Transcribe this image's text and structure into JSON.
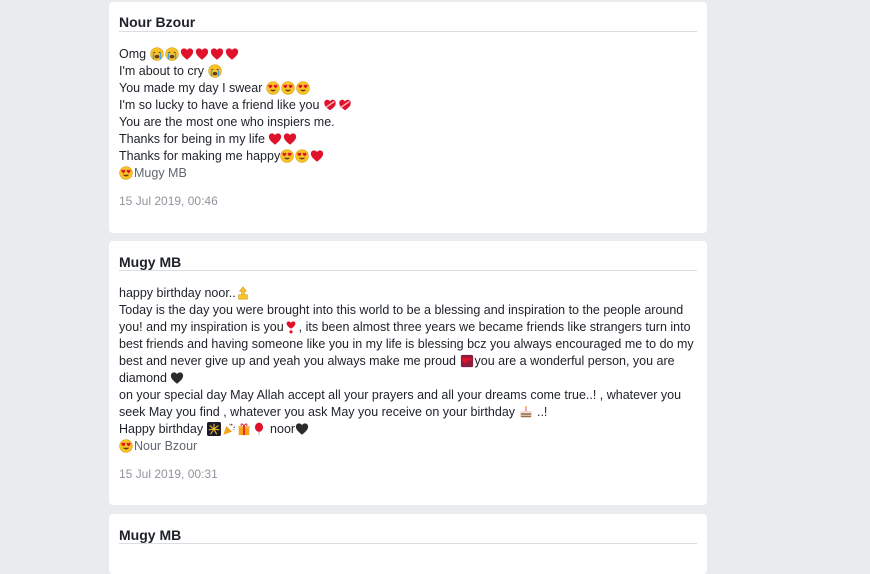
{
  "posts": [
    {
      "author": "Nour Bzour",
      "lines": [
        {
          "text": "Omg ",
          "emojis": [
            "crying-face-icon",
            "crying-face-icon",
            "heart-icon",
            "heart-icon",
            "heart-icon",
            "heart-icon"
          ]
        },
        {
          "text": "I'm about to cry ",
          "emojis": [
            "crying-face-icon"
          ]
        },
        {
          "text": "You made my day I swear ",
          "emojis": [
            "heart-eyes-icon",
            "heart-eyes-icon",
            "heart-eyes-icon"
          ]
        },
        {
          "text": "I'm so lucky to have a friend like you ",
          "emojis": [
            "heart-with-ribbon-icon",
            "heart-with-ribbon-icon"
          ]
        },
        {
          "text": "You are the most one who inspiers me.",
          "emojis": []
        },
        {
          "text": "Thanks for being in my life ",
          "emojis": [
            "heart-icon",
            "heart-icon"
          ]
        },
        {
          "text": "Thanks for making me happy",
          "emojis": [
            "heart-eyes-icon",
            "heart-eyes-icon",
            "heart-icon"
          ]
        }
      ],
      "signature": "Mugy MB",
      "timestamp": "15 Jul 2019, 00:46"
    },
    {
      "author": "Mugy MB",
      "intro": "happy birthday noor..",
      "paragraph1": "Today is the day you were brought into this world to be a blessing and inspiration to the people around you! and my inspiration is you",
      "paragraph1b": ", its been almost three years we became friends like strangers turn into best friends and having someone like you in my life is blessing bcz you always encouraged me to do my best and never give up and yeah you always make me proud ",
      "paragraph1c": "you are a wonderful person, you are diamond ",
      "paragraph2": "on your special day May Allah accept all your prayers and all your dreams come true..! , whatever you seek May you find , whatever you ask May you receive on your birthday ",
      "paragraph2b": " ..!",
      "birthday_line": "Happy birthday ",
      "birthday_name": " noor",
      "signature": "Nour Bzour",
      "timestamp": "15 Jul 2019, 00:31"
    },
    {
      "author": "Mugy MB"
    }
  ],
  "colors": {
    "page_bg": "#e9ebee",
    "card_bg": "#ffffff",
    "heart": "#e0112b",
    "emoji_yellow": "#f7c325",
    "black_heart": "#2b2b2b"
  }
}
